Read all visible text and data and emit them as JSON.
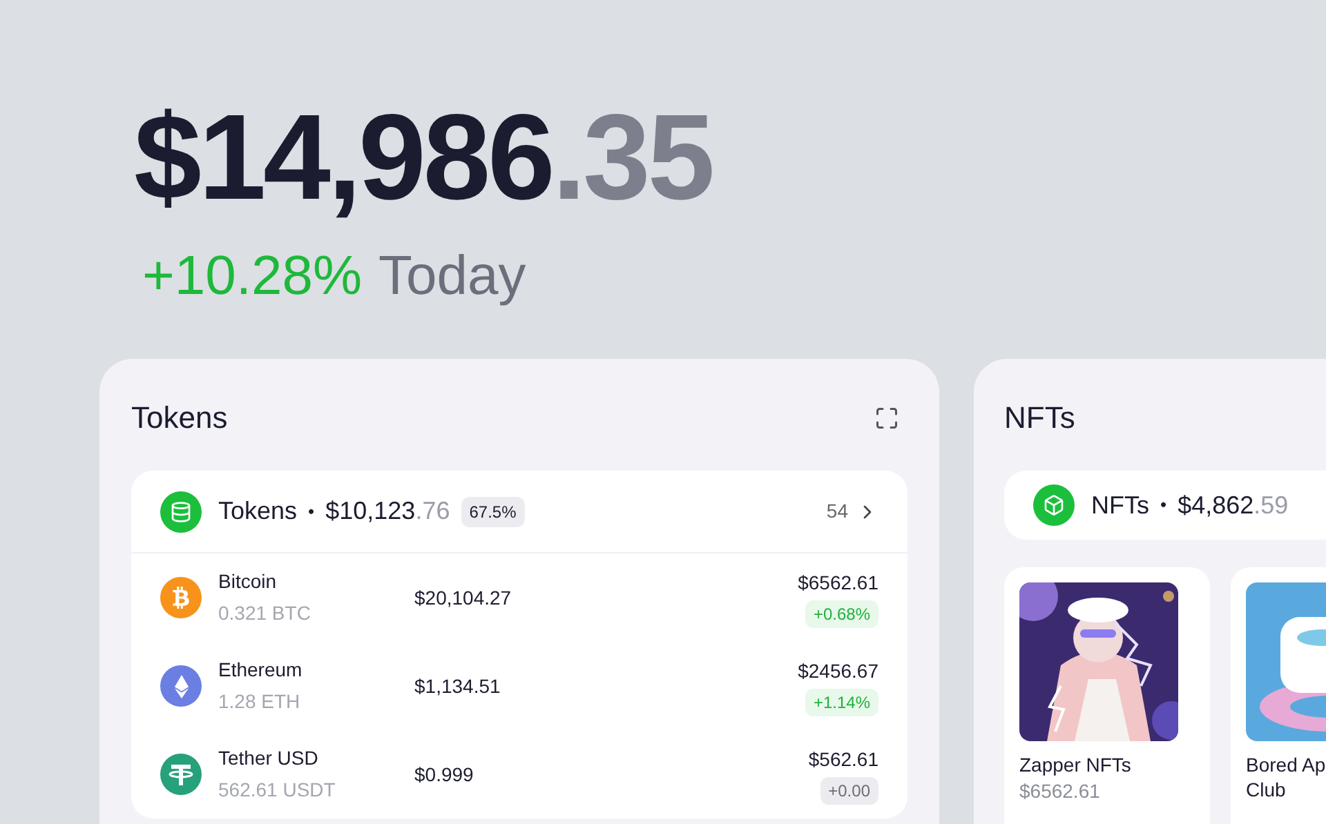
{
  "balance": {
    "whole": "$14,986",
    "cents": ".35"
  },
  "change": {
    "percent": "+10.28%",
    "period": "Today"
  },
  "tokens_panel": {
    "title": "Tokens",
    "summary": {
      "label": "Tokens",
      "separator": "•",
      "whole": "$10,123",
      "cents": ".76",
      "share": "67.5%",
      "count": "54"
    },
    "rows": [
      {
        "kind": "bitcoin",
        "name": "Bitcoin",
        "amount": "0.321 BTC",
        "price": "$20,104.27",
        "value": "$6562.61",
        "change": "+0.68%",
        "positive": true
      },
      {
        "kind": "ethereum",
        "name": "Ethereum",
        "amount": "1.28 ETH",
        "price": "$1,134.51",
        "value": "$2456.67",
        "change": "+1.14%",
        "positive": true
      },
      {
        "kind": "tether",
        "name": "Tether USD",
        "amount": "562.61 USDT",
        "price": "$0.999",
        "value": "$562.61",
        "change": "+0.00",
        "positive": false
      }
    ]
  },
  "nfts_panel": {
    "title": "NFTs",
    "summary": {
      "label": "NFTs",
      "separator": "•",
      "whole": "$4,862",
      "cents": ".59"
    },
    "items": [
      {
        "name_lines": [
          "Zapper NFTs"
        ],
        "value": "$6562.61"
      },
      {
        "name_lines": [
          "Bored Ap",
          "Club"
        ]
      }
    ]
  }
}
